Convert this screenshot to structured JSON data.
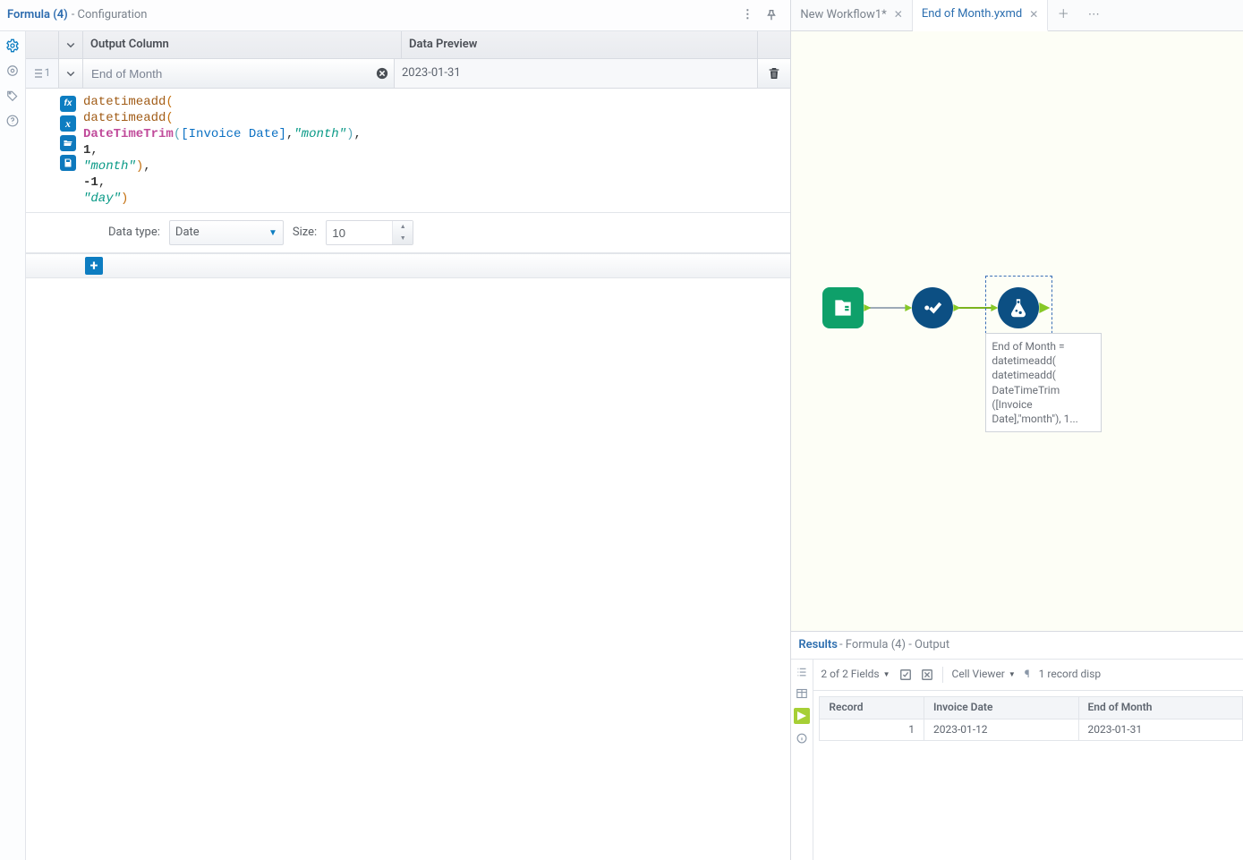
{
  "config": {
    "title": "Formula (4)",
    "subtitle": "- Configuration",
    "gridHeader": {
      "output": "Output Column",
      "preview": "Data Preview"
    },
    "rowIndex": "1",
    "outputValue": "End of Month",
    "previewValue": "2023-01-31",
    "formula": {
      "fn_out": "datetimeadd",
      "fn_in": "datetimeadd",
      "fn_trim": "DateTimeTrim",
      "field": "[Invoice Date]",
      "trim_arg": "\"month\"",
      "arg1": "1",
      "arg1_unit": "\"month\"",
      "arg2": "-1",
      "arg2_unit": "\"day\""
    },
    "dataTypeLabel": "Data type:",
    "dataTypeValue": "Date",
    "sizeLabel": "Size:",
    "sizeValue": "10"
  },
  "tabs": [
    {
      "label": "New Workflow1*",
      "active": false
    },
    {
      "label": "End of Month.yxmd",
      "active": true
    }
  ],
  "canvas": {
    "annotation": "End of Month = datetimeadd( datetimeadd( DateTimeTrim ([Invoice Date],\"month\"), 1..."
  },
  "results": {
    "title": "Results",
    "subtitle": "- Formula (4) - Output",
    "fieldsLabel": "2 of 2 Fields",
    "cellViewerLabel": "Cell Viewer",
    "recordCountLabel": "1 record disp",
    "columns": [
      "Record",
      "Invoice Date",
      "End of Month"
    ],
    "rows": [
      {
        "record": "1",
        "invoice": "2023-01-12",
        "eom": "2023-01-31"
      }
    ]
  }
}
